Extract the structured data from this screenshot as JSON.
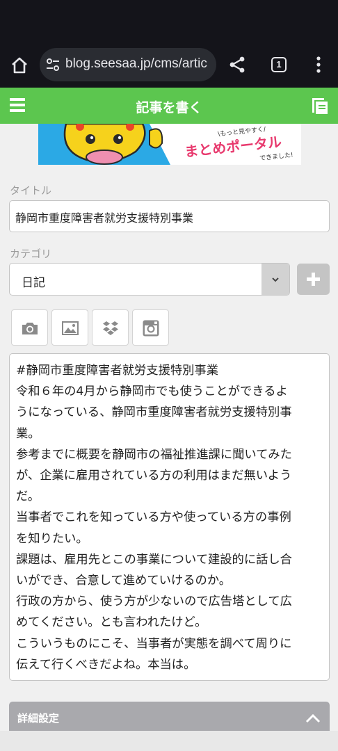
{
  "browser": {
    "url": "blog.seesaa.jp/cms/artic",
    "tab_count": "1",
    "icons": [
      "home-icon",
      "tune-icon",
      "share-icon",
      "tab-switcher-icon",
      "more-vert-icon"
    ]
  },
  "app": {
    "header_title": "記事を書く",
    "accent_color": "#5cc64f",
    "icons": [
      "hamburger-menu-icon",
      "documents-icon"
    ]
  },
  "banner": {
    "small_text": "\\もっと見やすく/",
    "main_text": "まとめポータル",
    "sub_text": "できました!"
  },
  "form": {
    "title_label": "タイトル",
    "title_value": "静岡市重度障害者就労支援特別事業",
    "category_label": "カテゴリ",
    "category_value": "日記",
    "add_category_icon": "plus-icon",
    "media_buttons": [
      {
        "icon": "camera-icon"
      },
      {
        "icon": "image-icon"
      },
      {
        "icon": "dropbox-icon"
      },
      {
        "icon": "instagram-icon"
      }
    ],
    "body_lines": [
      "#静岡市重度障害者就労支援特別事業",
      "令和６年の4月から静岡市でも使うことができるよ",
      "うになっている、静岡市重度障害者就労支援特別事",
      "業。",
      "参考までに概要を静岡市の福祉推進課に聞いてみた",
      "が、企業に雇用されている方の利用はまだ無いよう",
      "だ。",
      "当事者でこれを知っている方や使っている方の事例",
      "を知りたい。",
      "課題は、雇用先とこの事業について建設的に話し合",
      "いができ、合意して進めていけるのか。",
      "行政の方から、使う方が少ないので広告塔として広",
      "めてください。とも言われたけど。",
      "こういうものにこそ、当事者が実態を調べて周りに",
      "伝えて行くべきだよね。本当は。"
    ]
  },
  "details": {
    "label": "詳細設定",
    "toggle_icon": "chevron-up-icon"
  }
}
